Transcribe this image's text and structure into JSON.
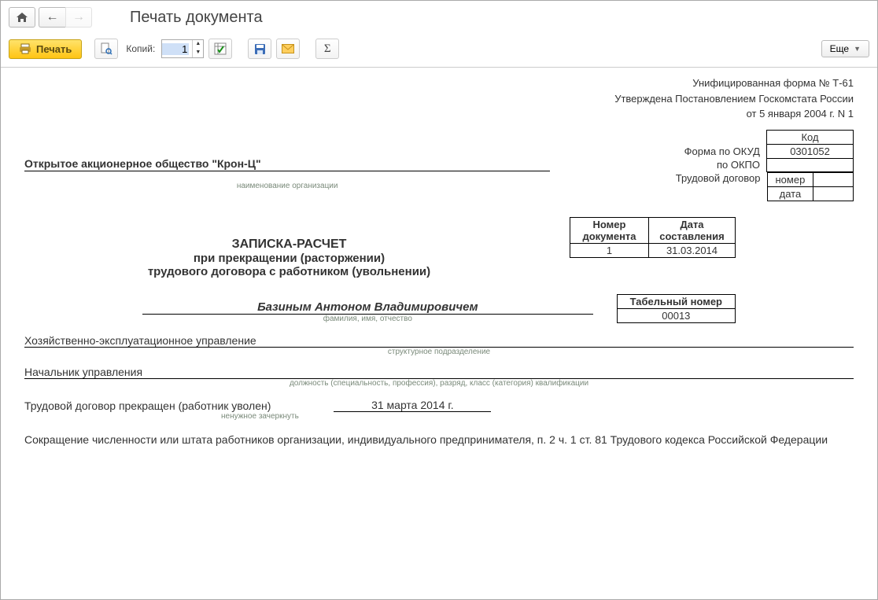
{
  "header": {
    "title": "Печать документа"
  },
  "toolbar": {
    "print_label": "Печать",
    "copies_label": "Копий:",
    "copies_value": "1",
    "more_label": "Еще"
  },
  "form": {
    "approval_line1": "Унифицированная форма № Т-61",
    "approval_line2": "Утверждена Постановлением Госкомстата России",
    "approval_line3": "от 5 января 2004 г. N 1",
    "code_header": "Код",
    "okud_label": "Форма по ОКУД",
    "okud_value": "0301052",
    "okpo_label": "по ОКПО",
    "okpo_value": "",
    "contract_label": "Трудовой договор",
    "number_label": "номер",
    "number_value": "",
    "date_label": "дата",
    "date_value": "",
    "org_name": "Открытое акционерное общество \"Крон-Ц\"",
    "org_caption": "наименование организации",
    "doc_num_header": "Номер документа",
    "doc_date_header": "Дата составления",
    "doc_num_value": "1",
    "doc_date_value": "31.03.2014",
    "title1": "ЗАПИСКА-РАСЧЕТ",
    "title2": "при прекращении (расторжении)",
    "title3": "трудового договора с работником (увольнении)",
    "tabnum_header": "Табельный номер",
    "tabnum_value": "00013",
    "employee_name": "Базиным Антоном Владимировичем",
    "fio_caption": "фамилия, имя, отчество",
    "department": "Хозяйственно-эксплуатационное управление",
    "department_caption": "структурное подразделение",
    "position": "Начальник управления",
    "position_caption": "должность (специальность, профессия), разряд, класс (категория) квалификации",
    "termination_label": "Трудовой договор прекращен (работник уволен)",
    "termination_caption": "ненужное зачеркнуть",
    "termination_date": "31 марта 2014 г.",
    "reason": "Сокращение численности или штата работников организации, индивидуального предпринимателя, п. 2 ч. 1 ст. 81 Трудового кодекса Российской Федерации"
  }
}
